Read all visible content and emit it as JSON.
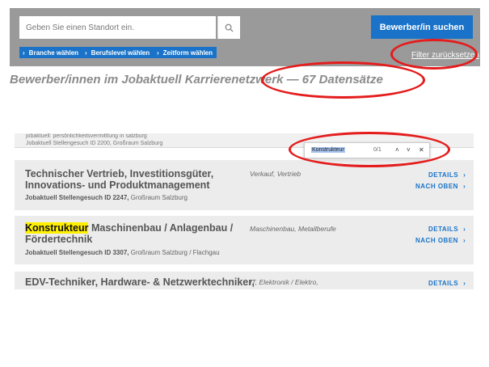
{
  "filter": {
    "search_placeholder": "Geben Sie einen Standort ein.",
    "chips": [
      "Branche wählen",
      "Berufslevel wählen",
      "Zeitform wählen"
    ],
    "search_button_label": "Bewerber/in suchen",
    "reset_label": "Filter zurücksetzen"
  },
  "results_heading": "Bewerber/innen im Jobaktuell Karrierenetzwerk — 67 Datensätze",
  "browser_strip": {
    "title_text": "jobaktuell: persönlichkeitsvermittlung in salzburg",
    "partial_id": "Jobaktuell Stellengesuch ID 2200, Großraum Salzburg"
  },
  "findbar": {
    "term": "Konstrukteur",
    "count": "0/1",
    "up": "˄",
    "down": "˅",
    "close": "✕"
  },
  "jobs": [
    {
      "title_line1": "Technischer Vertrieb, Investitionsgüter,",
      "title_line2": "Innovations- und Produktmanagement",
      "meta_id": "Jobaktuell Stellengesuch ID 2247,",
      "meta_region": " Großraum Salzburg",
      "category": "Verkauf, Vertrieb",
      "details": "DETAILS",
      "top": "NACH OBEN"
    },
    {
      "title_highlight": "Konstrukteur",
      "title_line1_rest": " Maschinenbau / Anlagenbau /",
      "title_line2": "Fördertechnik",
      "meta_id": "Jobaktuell Stellengesuch ID 3307,",
      "meta_region": " Großraum Salzburg / Flachgau",
      "category": "Maschinenbau, Metallberufe",
      "details": "DETAILS",
      "top": "NACH OBEN"
    },
    {
      "title_line1": "EDV-Techniker, Hardware- & Netzwerktechniker,",
      "category": "IT, Elektronik / Elektro,",
      "details": "DETAILS"
    }
  ],
  "colors": {
    "accent": "#1a73c8",
    "panel": "#9a9a9a",
    "card": "#ececec",
    "annotation": "#e41c1c",
    "highlight": "#ffef00"
  }
}
